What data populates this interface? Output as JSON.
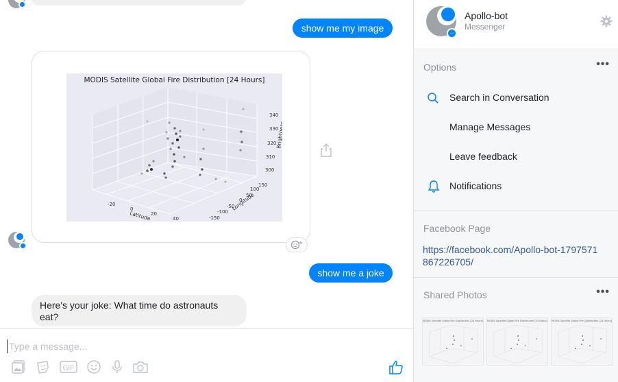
{
  "conversation": {
    "messages": {
      "out1": "show me my image",
      "out2": "show me a joke",
      "in1": "Here's your joke: What time do astronauts eat?"
    },
    "image_card": {
      "chart_data": {
        "type": "scatter",
        "title": "MODIS Satellite Global Fire Distribution [24 Hours]",
        "projection": "3d",
        "xlabel": "Latitude",
        "ylabel": "Longitude",
        "zlabel": "Brightness",
        "x_ticks": [
          "-20",
          "0",
          "20",
          "40"
        ],
        "y_ticks": [
          "-150",
          "-100",
          "-50",
          "0",
          "50",
          "100",
          "150"
        ],
        "z_ticks": [
          "300",
          "310",
          "320",
          "330",
          "340"
        ],
        "grid": true
      }
    },
    "composer": {
      "placeholder": "Type a message..."
    }
  },
  "info": {
    "contact_name": "Apollo-bot",
    "contact_subtitle": "Messenger",
    "options_title": "Options",
    "options": [
      "Search in Conversation",
      "Manage Messages",
      "Leave feedback",
      "Notifications"
    ],
    "facebook_page_title": "Facebook Page",
    "facebook_page_link": "https://facebook.com/Apollo-bot-1797571867226705/",
    "shared_photos_title": "Shared Photos",
    "thumb_caption": "MODIS Satellite Global Fire Distribution [24 Hours]"
  },
  "colors": {
    "accent": "#0084ff",
    "incoming_bubble": "#f1f0f0",
    "link": "#365899",
    "panel_bg": "#f6f7f9"
  }
}
